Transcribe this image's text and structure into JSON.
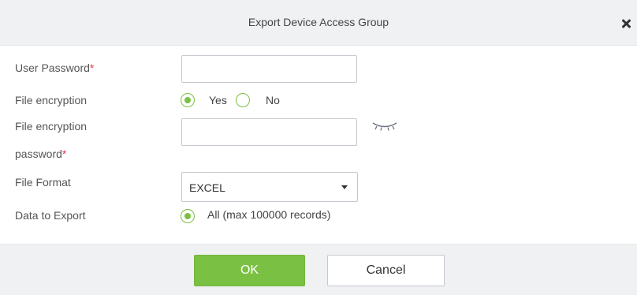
{
  "dialog": {
    "title": "Export Device Access Group"
  },
  "form": {
    "user_password": {
      "label": "User Password",
      "required_mark": "*",
      "value": ""
    },
    "file_encryption": {
      "label": "File encryption",
      "options": [
        "Yes",
        "No"
      ],
      "selected": "Yes"
    },
    "file_encryption_password": {
      "label_line1": "File encryption",
      "label_line2": "password",
      "required_mark": "*",
      "value": "",
      "visibility_icon": "eye-closed-icon"
    },
    "file_format": {
      "label": "File Format",
      "value": "EXCEL"
    },
    "data_to_export": {
      "label": "Data to Export",
      "option": "All (max 100000 records)",
      "selected": true
    }
  },
  "footer": {
    "ok_label": "OK",
    "cancel_label": "Cancel"
  },
  "colors": {
    "accent": "#7ac143",
    "required": "#e0384b",
    "header_bg": "#f0f1f3"
  }
}
